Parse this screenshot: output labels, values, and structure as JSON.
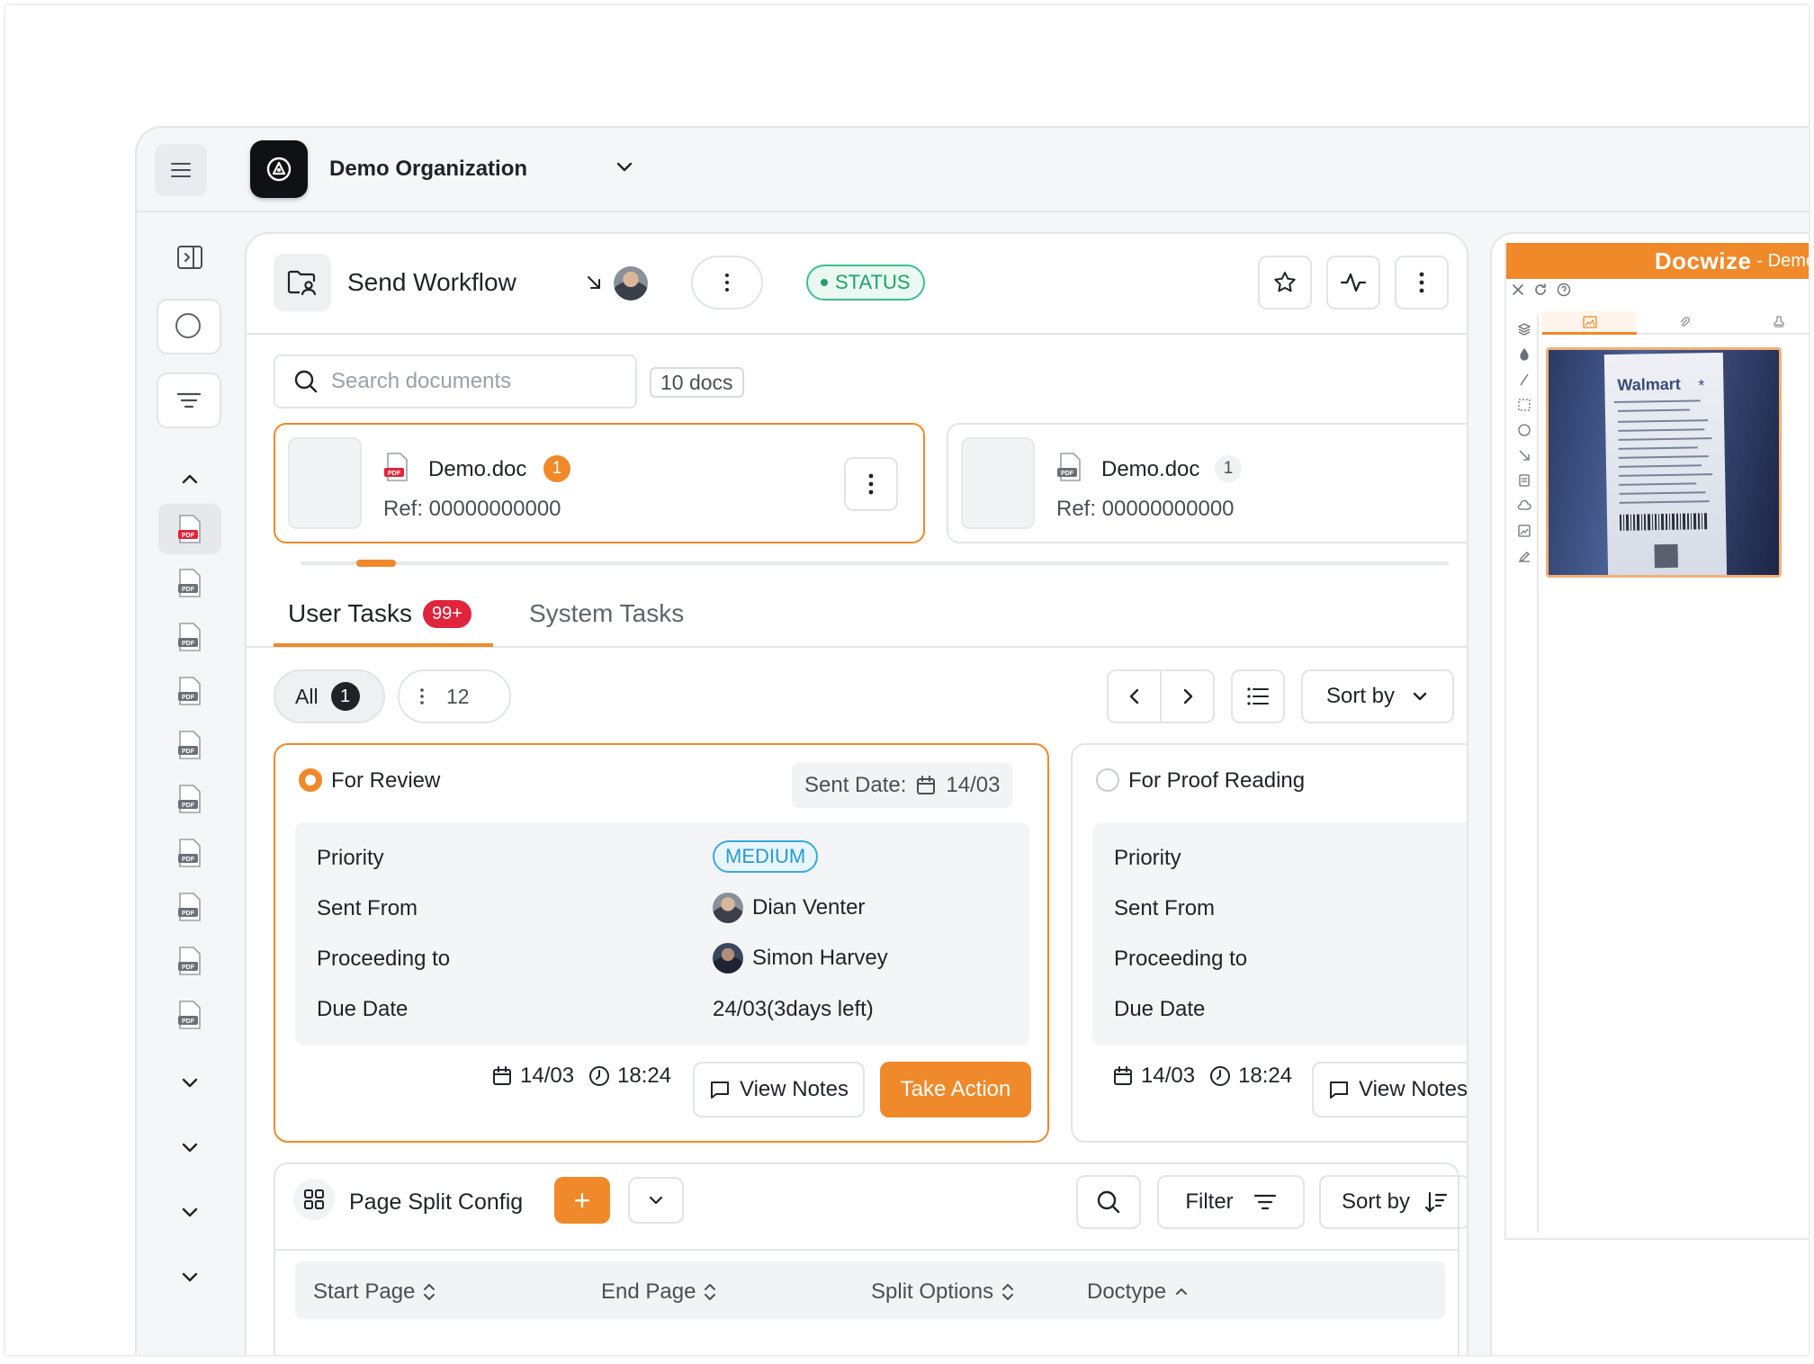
{
  "topbar": {
    "org_name": "Demo Organization"
  },
  "workflow": {
    "title": "Send Workflow",
    "status": "STATUS"
  },
  "documents": {
    "search_placeholder": "Search documents",
    "count_label": "10 docs",
    "cards": [
      {
        "name": "Demo.doc",
        "count": "1",
        "ref": "Ref: 00000000000",
        "selected": true
      },
      {
        "name": "Demo.doc",
        "count": "1",
        "ref": "Ref: 00000000000",
        "selected": false
      }
    ],
    "scroll_position": 0.05
  },
  "tabs": [
    {
      "label": "User Tasks",
      "badge": "99+",
      "active": true
    },
    {
      "label": "System Tasks",
      "active": false
    }
  ],
  "filters": {
    "all_label": "All",
    "all_count": "1",
    "more_count": "12",
    "sort_label": "Sort by"
  },
  "tasks": [
    {
      "title": "For Review",
      "selected": true,
      "sent_date_label": "Sent Date:",
      "sent_date_value": "14/03",
      "rows": {
        "priority_label": "Priority",
        "priority_value": "MEDIUM",
        "sent_from_label": "Sent From",
        "sent_from_value": "Dian Venter",
        "proceeding_label": "Proceeding to",
        "proceeding_value": "Simon Harvey",
        "due_label": "Due Date",
        "due_value": "24/03(3days left)"
      },
      "date": "14/03",
      "time": "18:24",
      "notes_label": "View Notes",
      "action_label": "Take Action"
    },
    {
      "title": "For Proof Reading",
      "selected": false,
      "rows": {
        "priority_label": "Priority",
        "sent_from_label": "Sent From",
        "proceeding_label": "Proceeding to",
        "due_label": "Due Date"
      },
      "date": "14/03",
      "time": "18:24",
      "notes_label": "View Notes"
    }
  ],
  "page_split": {
    "title": "Page Split Config",
    "add_label": "+",
    "filter_label": "Filter",
    "sort_label": "Sort by",
    "columns": [
      "Start Page",
      "End Page",
      "Split Options",
      "Doctype"
    ]
  },
  "viewer": {
    "brand": "Docwize",
    "brand_suffix": "- Demo"
  },
  "colors": {
    "accent": "#f0892a",
    "status_green": "#22a06b",
    "badge_red": "#e0243c",
    "medium_blue": "#2a9ad0"
  }
}
